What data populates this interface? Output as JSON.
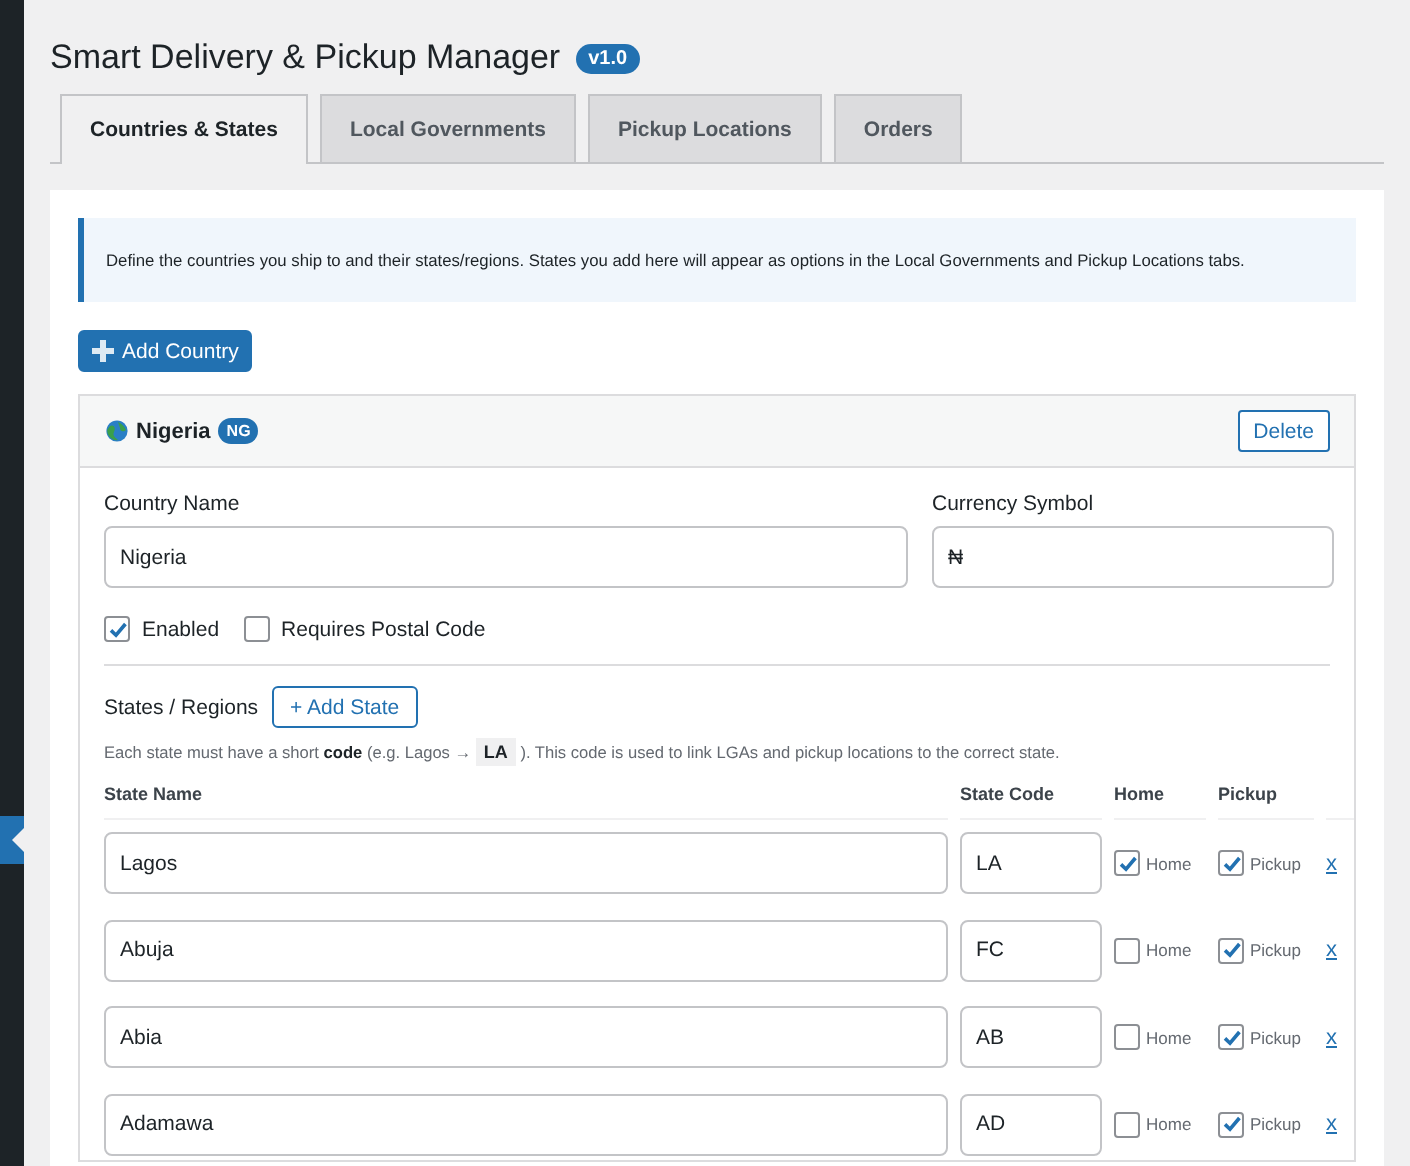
{
  "title": "Smart Delivery & Pickup Manager",
  "version": "v1.0",
  "tabs": [
    {
      "label": "Countries & States",
      "selected": true
    },
    {
      "label": "Local Governments",
      "selected": false
    },
    {
      "label": "Pickup Locations",
      "selected": false
    },
    {
      "label": "Orders",
      "selected": false
    }
  ],
  "notice": "Define the countries you ship to and their states/regions. States you add here will appear as options in the Local Governments and Pickup Locations tabs.",
  "add_country_button": "Add Country",
  "countries": [
    {
      "name": "Nigeria",
      "code": "NG",
      "delete_button": "Delete",
      "fields": [
        {
          "label": "Country Name",
          "value": "Nigeria"
        },
        {
          "label": "Currency Symbol",
          "value": "₦"
        }
      ],
      "options": [
        {
          "label": "Enabled",
          "checked": true
        },
        {
          "label": "Requires Postal Code",
          "checked": false
        }
      ],
      "states_label": "States / Regions",
      "add_state_button": "+ Add State",
      "help": {
        "before": "Each state must have a short **code** (e.g. Lagos →",
        "code": "LA",
        "after": "). This code is used to link LGAs and pickup locations to the correct state."
      },
      "columns": [
        "State Name",
        "State Code",
        "Home",
        "Pickup"
      ],
      "states": [
        {
          "name": "Lagos",
          "code": "LA",
          "home": {
            "label": "Home",
            "checked": true
          },
          "pickup": {
            "label": "Pickup",
            "checked": true
          },
          "remove": "x"
        },
        {
          "name": "Abuja",
          "code": "FC",
          "home": {
            "label": "Home",
            "checked": false
          },
          "pickup": {
            "label": "Pickup",
            "checked": true
          },
          "remove": "x"
        },
        {
          "name": "Abia",
          "code": "AB",
          "home": {
            "label": "Home",
            "checked": false
          },
          "pickup": {
            "label": "Pickup",
            "checked": true
          },
          "remove": "x"
        },
        {
          "name": "Adamawa",
          "code": "AD",
          "home": {
            "label": "Home",
            "checked": false
          },
          "pickup": {
            "label": "Pickup",
            "checked": true
          },
          "remove": "x"
        }
      ]
    }
  ]
}
